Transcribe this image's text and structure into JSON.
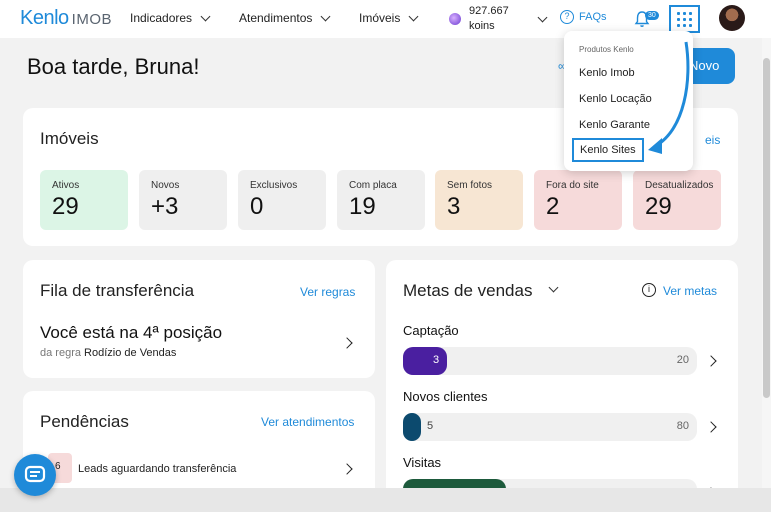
{
  "brand": {
    "name": "Kenlo",
    "product": "IMOB"
  },
  "nav": {
    "indicadores": "Indicadores",
    "atendimentos": "Atendimentos",
    "imoveis": "Imóveis",
    "koins_line1": "927.667",
    "koins_line2": "koins",
    "faqs": "FAQs",
    "notif_count": "30"
  },
  "greeting": "Boa tarde, Bruna!",
  "new_button": "Novo",
  "imoveis_card": {
    "title": "Imóveis",
    "link": "eis",
    "stats": [
      {
        "label": "Ativos",
        "value": "29",
        "bg": "#dcf5e6"
      },
      {
        "label": "Novos",
        "value": "+3",
        "bg": "#efefef"
      },
      {
        "label": "Exclusivos",
        "value": "0",
        "bg": "#efefef"
      },
      {
        "label": "Com placa",
        "value": "19",
        "bg": "#efefef"
      },
      {
        "label": "Sem fotos",
        "value": "3",
        "bg": "#f7e6d3"
      },
      {
        "label": "Fora do site",
        "value": "2",
        "bg": "#f6dada"
      },
      {
        "label": "Desatualizados",
        "value": "29",
        "bg": "#f6dada"
      }
    ]
  },
  "fila": {
    "title": "Fila de transferência",
    "link": "Ver regras",
    "position_text": "Você está na 4ª posição",
    "rule_prefix": "da regra",
    "rule_name": "Rodízio de Vendas"
  },
  "pendencias": {
    "title": "Pendências",
    "link": "Ver atendimentos",
    "item_count": "6",
    "item_label": "Leads aguardando transferência"
  },
  "metas": {
    "title": "Metas de vendas",
    "link": "Ver metas",
    "rows": [
      {
        "label": "Captação",
        "current": "3",
        "target": "20",
        "fraction": 0.15,
        "color": "#4a1fa0"
      },
      {
        "label": "Novos clientes",
        "current": "5",
        "target": "80",
        "fraction": 0.0625,
        "color": "#0c4a6e"
      },
      {
        "label": "Visitas",
        "current": "",
        "target": "",
        "fraction": 0.35,
        "color": "#1d5a3c"
      }
    ]
  },
  "dropdown": {
    "header": "Produtos Kenlo",
    "items": [
      "Kenlo Imob",
      "Kenlo Locação",
      "Kenlo Garante",
      "Kenlo Sites"
    ]
  }
}
